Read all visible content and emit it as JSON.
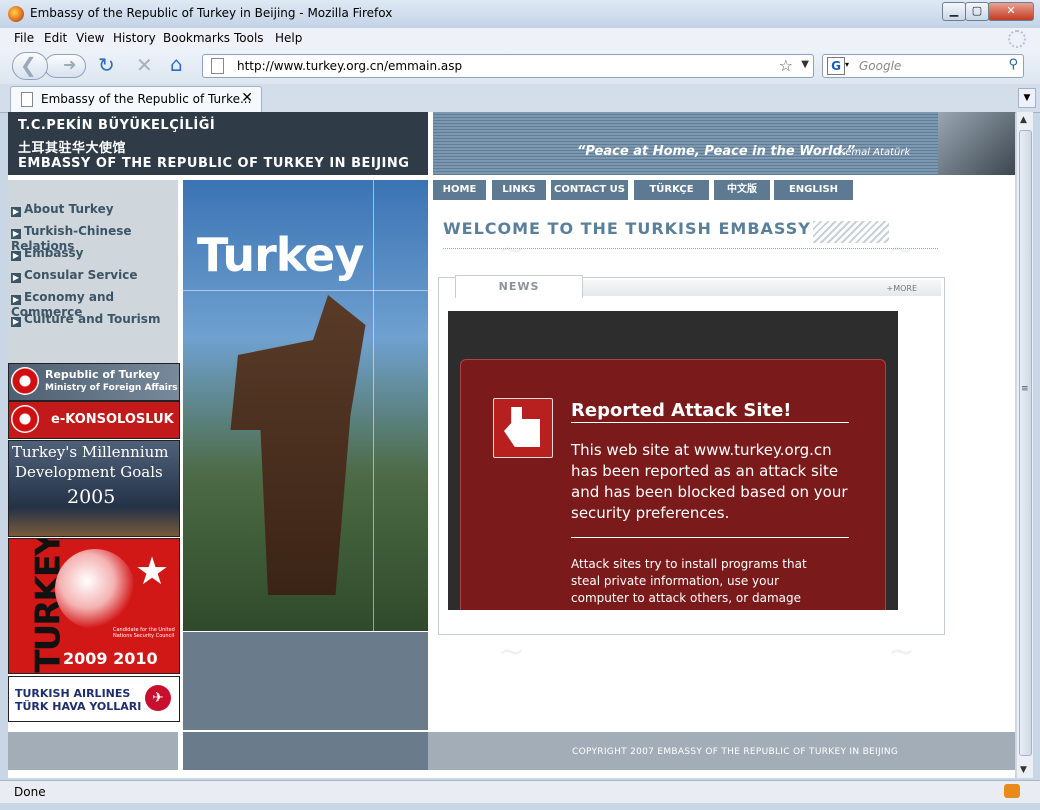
{
  "window": {
    "title": "Embassy of the Republic of Turkey in Beijing - Mozilla Firefox",
    "min_icon": "minimize-icon",
    "max_icon": "maximize-icon",
    "close_icon": "close-icon"
  },
  "menu": [
    "File",
    "Edit",
    "View",
    "History",
    "Bookmarks",
    "Tools",
    "Help"
  ],
  "navbar": {
    "url": "http://www.turkey.org.cn/emmain.asp",
    "search_engine": "G",
    "search_placeholder": "Google"
  },
  "tab": {
    "title": "Embassy of the Republic of Turke..."
  },
  "status": "Done",
  "page": {
    "header_lines": [
      "T.C.PEKİN BÜYÜKELÇİLİĞİ",
      "土耳其驻华大使馆",
      "EMBASSY OF THE REPUBLIC OF TURKEY IN BEIJING"
    ],
    "quote": "“Peace at Home, Peace in the World.”",
    "quote_author": "Kemal Atatürk",
    "nav": [
      "HOME",
      "LINKS",
      "CONTACT US",
      "TÜRKÇE",
      "中文版",
      "ENGLISH"
    ],
    "sidebar": [
      "About Turkey",
      "Turkish-Chinese Relations",
      "Embassy",
      "Consular Service",
      "Economy and Commerce",
      "Culture and Tourism"
    ],
    "banners": {
      "mfa_line1": "Republic of Turkey",
      "mfa_line2": "Ministry of Foreign Affairs",
      "ek": "e-KONSOLOSLUK",
      "mdg_line1": "Turkey's Millennium",
      "mdg_line2": "Development Goals",
      "mdg_year": "2005",
      "unsc_word": "TURKEY",
      "unsc_caption": "Candidate for the United Nations Security Council",
      "unsc_years": "2009 2010",
      "thy_line1": "TURKISH AIRLINES",
      "thy_line2": "TÜRK HAVA YOLLARI"
    },
    "photo_title": "Turkey",
    "welcome": "WELCOME TO THE TURKISH EMBASSY",
    "news_tab": "NEWS",
    "more": "+MORE",
    "copyright": "COPYRIGHT 2007 EMBASSY OF THE REPUBLIC OF TURKEY IN BEIJING"
  },
  "attack": {
    "title": "Reported Attack Site!",
    "body": "This web site at www.turkey.org.cn has been reported as an attack site and has been blocked based on your security preferences.",
    "sub": "Attack sites try to install programs that steal private information, use your computer to attack others, or damage",
    "icon": "police-officer-icon"
  },
  "colors": {
    "attack_bg": "#7a1a1a",
    "nav_tab": "#5d7a92",
    "header_dark": "#2f3c48"
  }
}
